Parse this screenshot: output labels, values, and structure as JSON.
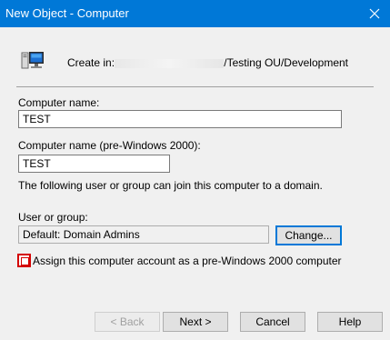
{
  "window": {
    "title": "New Object - Computer",
    "close_icon": "close-icon"
  },
  "create_in": {
    "label": "Create in:",
    "path": "/Testing OU/Development",
    "icon": "computer-icon"
  },
  "computer_name": {
    "label": "Computer name:",
    "value": "TEST"
  },
  "computer_name_pre2000": {
    "label": "Computer name (pre-Windows 2000):",
    "value": "TEST"
  },
  "info_text": "The following user or group can join this computer to a domain.",
  "user_or_group": {
    "label": "User or group:",
    "value": "Default: Domain Admins",
    "change_label": "Change..."
  },
  "pre2000_checkbox": {
    "label": "Assign this computer account as a pre-Windows 2000 computer",
    "checked": false
  },
  "buttons": {
    "back": "< Back",
    "next": "Next >",
    "cancel": "Cancel",
    "help": "Help"
  },
  "colors": {
    "titlebar": "#0078d7",
    "highlight": "#d40000",
    "dialog_bg": "#f0f0f0"
  }
}
